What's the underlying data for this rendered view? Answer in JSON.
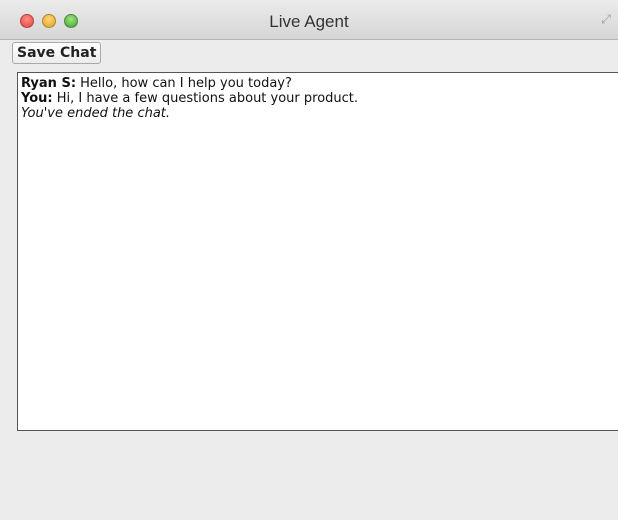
{
  "window": {
    "title": "Live Agent",
    "fullscreen_glyph": "⤢"
  },
  "toolbar": {
    "save_label": "Save Chat"
  },
  "chat": {
    "messages": [
      {
        "sender": "Ryan S:",
        "text": " Hello, how can I help you today?"
      },
      {
        "sender": "You:",
        "text": " Hi, I have a few questions about your product."
      }
    ],
    "status": "You've ended the chat."
  },
  "colors": {
    "close": "#e0443e",
    "minimize": "#dea123",
    "zoom": "#3ea43a"
  }
}
